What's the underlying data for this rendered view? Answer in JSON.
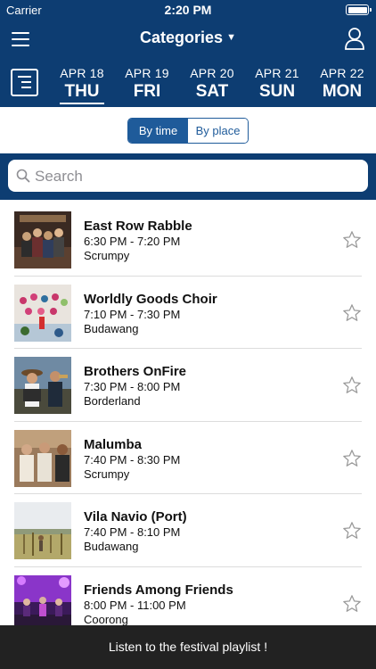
{
  "status": {
    "carrier": "Carrier",
    "time": "2:20 PM"
  },
  "header": {
    "title": "Categories",
    "menu_icon": "menu-icon",
    "user_icon": "user-icon"
  },
  "days": [
    {
      "month": "APR 18",
      "weekday": "THU",
      "selected": true
    },
    {
      "month": "APR 19",
      "weekday": "FRI",
      "selected": false
    },
    {
      "month": "APR 20",
      "weekday": "SAT",
      "selected": false
    },
    {
      "month": "APR 21",
      "weekday": "SUN",
      "selected": false
    },
    {
      "month": "APR 22",
      "weekday": "MON",
      "selected": false
    }
  ],
  "toggle": {
    "by_time": "By time",
    "by_place": "By place",
    "active": "by_time"
  },
  "search": {
    "placeholder": "Search"
  },
  "events": [
    {
      "title": "East Row Rabble",
      "time": "6:30 PM - 7:20 PM",
      "venue": "Scrumpy"
    },
    {
      "title": "Worldly Goods Choir",
      "time": "7:10 PM - 7:30 PM",
      "venue": "Budawang"
    },
    {
      "title": "Brothers OnFire",
      "time": "7:30 PM - 8:00 PM",
      "venue": "Borderland"
    },
    {
      "title": "Malumba",
      "time": "7:40 PM - 8:30 PM",
      "venue": "Scrumpy"
    },
    {
      "title": "Vila Navio (Port)",
      "time": "7:40 PM - 8:10 PM",
      "venue": "Budawang"
    },
    {
      "title": "Friends Among Friends",
      "time": "8:00 PM - 11:00 PM",
      "venue": "Coorong"
    }
  ],
  "footer": {
    "label": "Listen to the festival playlist !"
  },
  "colors": {
    "navy": "#0d3d72",
    "segment_blue": "#1f5b9a",
    "footer": "#222222",
    "star": "#9a9a9a"
  }
}
